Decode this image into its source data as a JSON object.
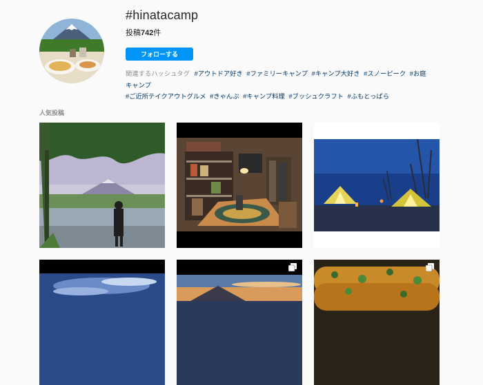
{
  "header": {
    "hashtag": "#hinatacamp",
    "posts_label": "投稿",
    "posts_count": "742",
    "posts_unit": "件",
    "follow_label": "フォローする"
  },
  "related": {
    "label": "関連するハッシュタグ",
    "tags": [
      "#アウトドア好き",
      "#ファミリーキャンプ",
      "#キャンプ大好き",
      "#スノーピーク",
      "#お庭キャンプ",
      "#ご近所テイクアウトグルメ",
      "#きゃんぷ",
      "#キャンプ料理",
      "#ブッシュクラフト",
      "#ふもとっぱら"
    ]
  },
  "top_posts_label": "人気投稿",
  "posts": [
    {
      "subject": "fuji-lake-person",
      "multi": false
    },
    {
      "subject": "camping-gear-room",
      "multi": false
    },
    {
      "subject": "night-tents",
      "multi": false
    },
    {
      "subject": "cloudy-sky",
      "multi": false
    },
    {
      "subject": "sunset-fuji",
      "multi": true
    },
    {
      "subject": "grilled-corn",
      "multi": true
    }
  ],
  "colors": {
    "accent": "#0095f6",
    "tag_link": "#00376b",
    "muted": "#8e8e8e"
  },
  "icons": {
    "multi_post": "carousel-icon"
  }
}
